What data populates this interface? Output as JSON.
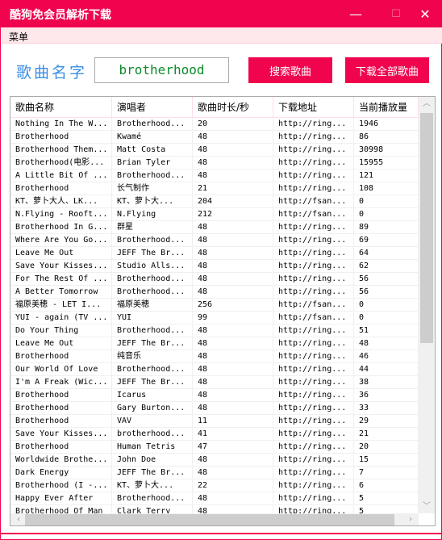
{
  "window": {
    "title": "酷狗免会员解析下载",
    "minimize": "—",
    "maximize": "☐",
    "close": "✕",
    "accent": "#f0044e"
  },
  "menu": {
    "label": "菜单"
  },
  "search": {
    "label": "歌曲名字",
    "value": "brotherhood",
    "search_button": "搜索歌曲",
    "download_all_button": "下载全部歌曲"
  },
  "table": {
    "columns": [
      "歌曲名称",
      "演唱者",
      "歌曲时长/秒",
      "下载地址",
      "当前播放量"
    ],
    "rows": [
      [
        "Nothing In The W...",
        "Brotherhood...",
        "20",
        "http://ring...",
        "1946"
      ],
      [
        "Brotherhood",
        "Kwamé",
        "48",
        "http://ring...",
        "86"
      ],
      [
        "Brotherhood Them...",
        "Matt Costa",
        "48",
        "http://ring...",
        "30998"
      ],
      [
        "Brotherhood(电影...",
        "Brian Tyler",
        "48",
        "http://ring...",
        "15955"
      ],
      [
        "A Little Bit Of ...",
        "Brotherhood...",
        "48",
        "http://ring...",
        "121"
      ],
      [
        "Brotherhood",
        "长气制作",
        "21",
        "http://ring...",
        "108"
      ],
      [
        "KT、萝卜大人、LK...",
        "KT、萝卜大...",
        "204",
        "http://fsan...",
        "0"
      ],
      [
        "N.Flying - Rooft...",
        "N.Flying",
        "212",
        "http://fsan...",
        "0"
      ],
      [
        "Brotherhood In G...",
        "群星",
        "48",
        "http://ring...",
        "89"
      ],
      [
        "Where Are You Go...",
        "Brotherhood...",
        "48",
        "http://ring...",
        "69"
      ],
      [
        "Leave Me Out",
        "JEFF The Br...",
        "48",
        "http://ring...",
        "64"
      ],
      [
        "Save Your Kisses...",
        "Studio Alls...",
        "48",
        "http://ring...",
        "62"
      ],
      [
        "For The Rest Of ...",
        "Brotherhood...",
        "48",
        "http://ring...",
        "56"
      ],
      [
        "A Better Tomorrow",
        "Brotherhood...",
        "48",
        "http://ring...",
        "56"
      ],
      [
        "福原美穂 - LET I...",
        "福原美穂",
        "256",
        "http://fsan...",
        "0"
      ],
      [
        "YUI - again (TV ...",
        "YUI",
        "99",
        "http://fsan...",
        "0"
      ],
      [
        "Do Your Thing",
        "Brotherhood...",
        "48",
        "http://ring...",
        "51"
      ],
      [
        "Leave Me Out",
        "JEFF The Br...",
        "48",
        "http://ring...",
        "48"
      ],
      [
        "Brotherhood",
        "纯音乐",
        "48",
        "http://ring...",
        "46"
      ],
      [
        "Our World Of Love",
        "Brotherhood...",
        "48",
        "http://ring...",
        "44"
      ],
      [
        "I'm A Freak (Wic...",
        "JEFF The Br...",
        "48",
        "http://ring...",
        "38"
      ],
      [
        "Brotherhood",
        "Icarus",
        "48",
        "http://ring...",
        "36"
      ],
      [
        "Brotherhood",
        "Gary Burton...",
        "48",
        "http://ring...",
        "33"
      ],
      [
        "Brotherhood",
        "VAV",
        "11",
        "http://ring...",
        "29"
      ],
      [
        "Save Your Kisses...",
        "brotherhood...",
        "41",
        "http://ring...",
        "21"
      ],
      [
        "Brotherhood",
        "Human Tetris",
        "47",
        "http://ring...",
        "20"
      ],
      [
        "Worldwide Brothe...",
        "John Doe",
        "48",
        "http://ring...",
        "15"
      ],
      [
        "Dark Energy",
        "JEFF The Br...",
        "48",
        "http://ring...",
        "7"
      ],
      [
        "Brotherhood (I -...",
        "KT、萝卜大...",
        "22",
        "http://ring...",
        "6"
      ],
      [
        "Happy Ever After",
        "Brotherhood...",
        "48",
        "http://ring...",
        "5"
      ],
      [
        "Brotherhood Of Man",
        "Clark Terry",
        "48",
        "http://ring...",
        "5"
      ]
    ]
  }
}
